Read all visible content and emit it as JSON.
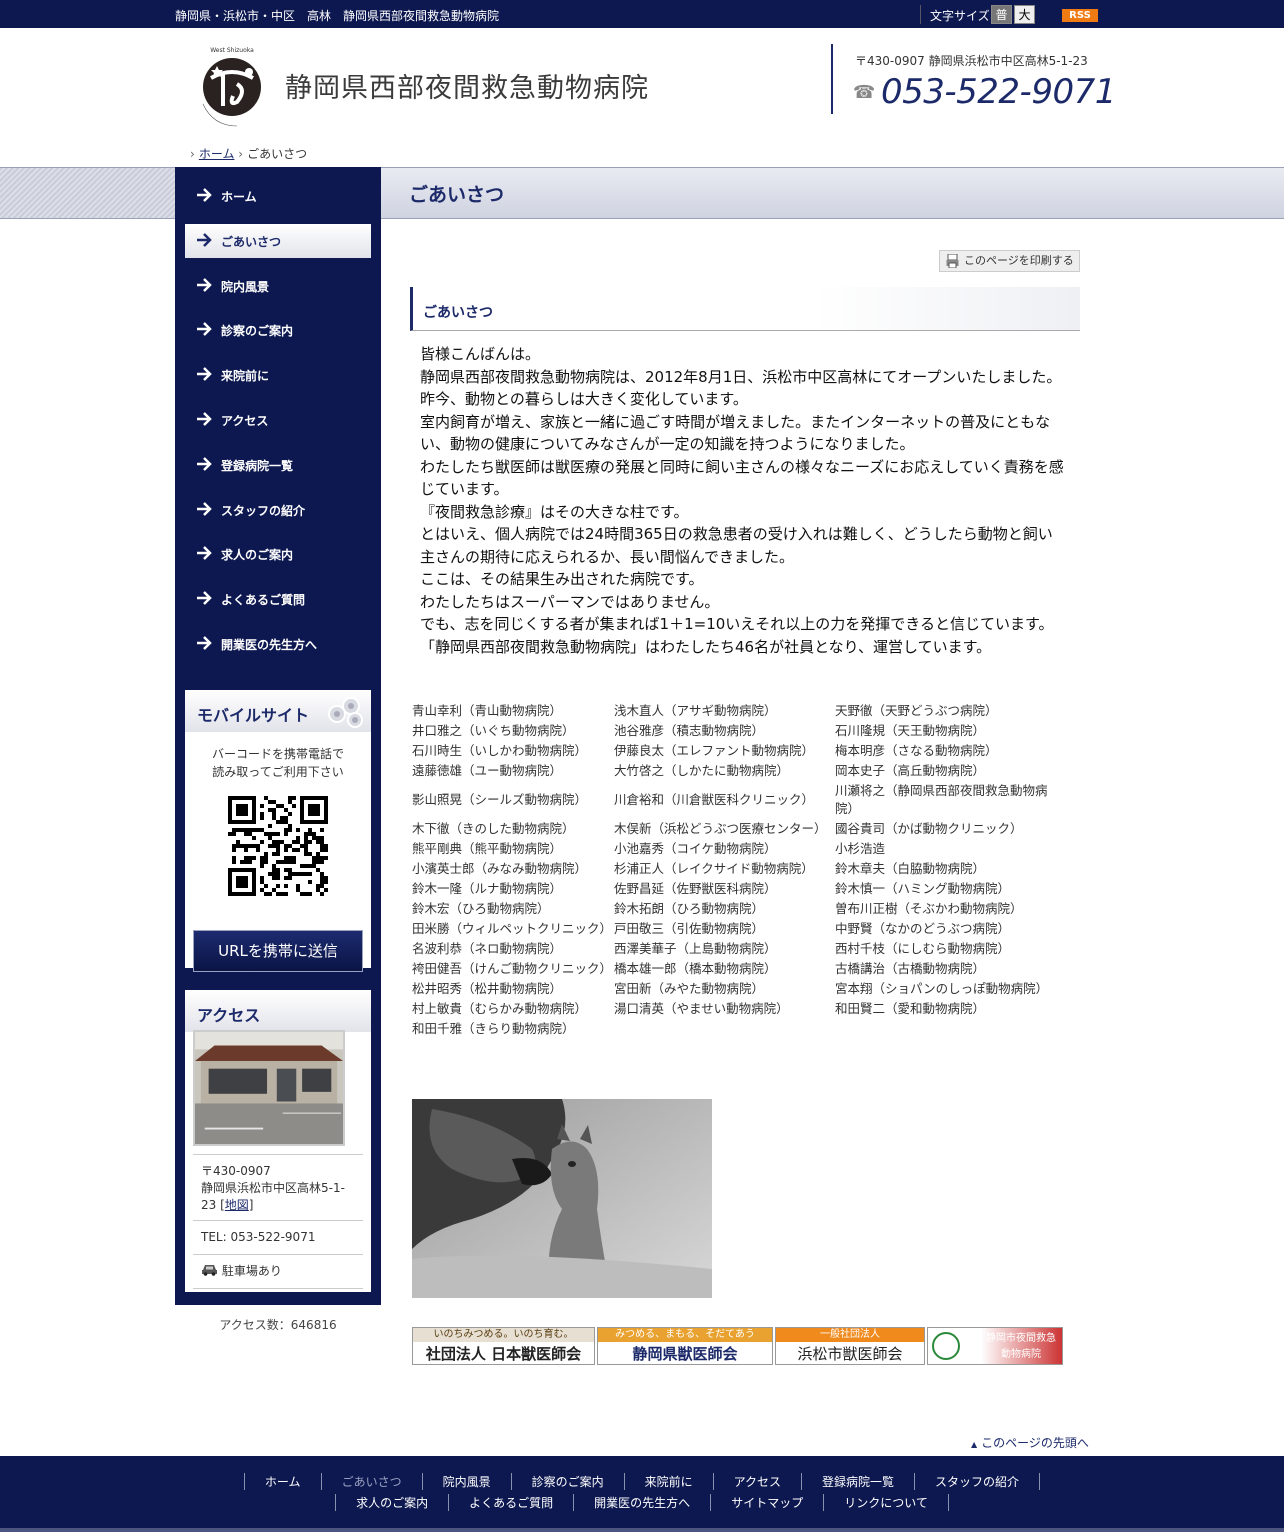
{
  "topbar": {
    "tagline": "静岡県・浜松市・中区　高林　静岡県西部夜間救急動物病院",
    "font_size_label": "文字サイズ",
    "font_size_normal": "普",
    "font_size_large": "大",
    "rss": "RSS"
  },
  "header": {
    "site_title": "静岡県西部夜間救急動物病院",
    "address": "〒430-0907 静岡県浜松市中区高林5-1-23",
    "phone": "053-522-9071"
  },
  "breadcrumb": {
    "home": "ホーム",
    "current": "ごあいさつ"
  },
  "page_heading": "ごあいさつ",
  "sidebar": {
    "nav": [
      {
        "label": "ホーム",
        "active": false
      },
      {
        "label": "ごあいさつ",
        "active": true
      },
      {
        "label": "院内風景",
        "active": false
      },
      {
        "label": "診察のご案内",
        "active": false
      },
      {
        "label": "来院前に",
        "active": false
      },
      {
        "label": "アクセス",
        "active": false
      },
      {
        "label": "登録病院一覧",
        "active": false
      },
      {
        "label": "スタッフの紹介",
        "active": false
      },
      {
        "label": "求人のご案内",
        "active": false
      },
      {
        "label": "よくあるご質問",
        "active": false
      },
      {
        "label": "開業医の先生方へ",
        "active": false
      }
    ],
    "mobile": {
      "title": "モバイルサイト",
      "text_line1": "バーコードを携帯電話で",
      "text_line2": "読み取ってご利用下さい",
      "url_button": "URLを携帯に送信"
    },
    "access": {
      "title": "アクセス",
      "postal": "〒430-0907",
      "address": "静岡県浜松市中区高林5-1-23",
      "map_link": "地図",
      "tel": "TEL: 053-522-9071",
      "parking": "駐車場あり"
    },
    "access_count": "アクセス数：646816"
  },
  "main": {
    "print_button": "このページを印刷する",
    "section_title": "ごあいさつ",
    "intro": [
      "皆様こんばんは。",
      "静岡県西部夜間救急動物病院は、2012年8月1日、浜松市中区高林にてオープンいたしました。",
      "昨今、動物との暮らしは大きく変化しています。",
      "室内飼育が増え、家族と一緒に過ごす時間が増えました。またインターネットの普及にともない、動物の健康についてみなさんが一定の知識を持つようになりました。",
      "わたしたち獣医師は獣医療の発展と同時に飼い主さんの様々なニーズにお応えしていく責務を感じています。",
      "『夜間救急診療』はその大きな柱です。",
      "とはいえ、個人病院では24時間365日の救急患者の受け入れは難しく、どうしたら動物と飼い主さんの期待に応えられるか、長い間悩んできました。",
      "ここは、その結果生み出された病院です。",
      "わたしたちはスーパーマンではありません。",
      "でも、志を同じくする者が集まれば1＋1=10いえそれ以上の力を発揮できると信じています。",
      "「静岡県西部夜間救急動物病院」はわたしたち46名が社員となり、運営しています。"
    ],
    "staff": [
      [
        "青山幸利（青山動物病院）",
        "浅木直人（アサギ動物病院）",
        "天野徹（天野どうぶつ病院）"
      ],
      [
        "井口雅之（いぐち動物病院）",
        "池谷雅彦（積志動物病院）",
        "石川隆規（天王動物病院）"
      ],
      [
        "石川時生（いしかわ動物病院）",
        "伊藤良太（エレファント動物病院）",
        "梅本明彦（さなる動物病院）"
      ],
      [
        "遠藤徳雄（ユー動物病院）",
        "大竹啓之（しかたに動物病院）",
        "岡本史子（高丘動物病院）"
      ],
      [
        "影山照晃（シールズ動物病院）",
        "川倉裕和（川倉獣医科クリニック）",
        "川瀬将之（静岡県西部夜間救急動物病院）"
      ],
      [
        "木下徹（きのした動物病院）",
        "木俣新（浜松どうぶつ医療センター）",
        "國谷貴司（かば動物クリニック）"
      ],
      [
        "熊平剛典（熊平動物病院）",
        "小池嘉秀（コイケ動物病院）",
        "小杉浩造"
      ],
      [
        "小濱英士郎（みなみ動物病院）",
        "杉浦正人（レイクサイド動物病院）",
        "鈴木章夫（白脇動物病院）"
      ],
      [
        "鈴木一隆（ルナ動物病院）",
        "佐野昌延（佐野獣医科病院）",
        "鈴木慎一（ハミング動物病院）"
      ],
      [
        "鈴木宏（ひろ動物病院）",
        "鈴木拓朗（ひろ動物病院）",
        "曽布川正樹（そぶかわ動物病院）"
      ],
      [
        "田米勝（ウィルペットクリニック）",
        "戸田敬三（引佐動物病院）",
        "中野賢（なかのどうぶつ病院）"
      ],
      [
        "名波利恭（ネロ動物病院）",
        "西澤美華子（上島動物病院）",
        "西村千枝（にしむら動物病院）"
      ],
      [
        "袴田健吾（けんご動物クリニック）",
        "橋本雄一郎（橋本動物病院）",
        "古橋講治（古橋動物病院）"
      ],
      [
        "松井昭秀（松井動物病院）",
        "宮田新（みやた動物病院）",
        "宮本翔（ショパンのしっぽ動物病院）"
      ],
      [
        "村上敏貴（むらかみ動物病院）",
        "湯口清英（やませい動物病院）",
        "和田賢二（愛和動物病院）"
      ],
      [
        "和田千雅（きらり動物病院）",
        "",
        ""
      ]
    ],
    "banners": {
      "jvma_top": "いのちみつめる。いのち育む。",
      "jvma_main": "社団法人 日本獣医師会",
      "shizuoka_top": "みつめる、まもる、そだてあう",
      "shizuoka_main": "静岡県獣医師会",
      "hamamatsu_top": "一般社団法人",
      "hamamatsu_main": "浜松市獣医師会",
      "shizuoka_city_line1": "静岡市夜間救急",
      "shizuoka_city_line2": "動物病院"
    },
    "to_top": "このページの先頭へ"
  },
  "footer": {
    "row1": [
      "ホーム",
      "ごあいさつ",
      "院内風景",
      "診察のご案内",
      "来院前に",
      "アクセス",
      "登録病院一覧",
      "スタッフの紹介"
    ],
    "row2": [
      "求人のご案内",
      "よくあるご質問",
      "開業医の先生方へ",
      "サイトマップ",
      "リンクについて"
    ]
  },
  "colors": {
    "navy": "#0d1850",
    "accent": "#1c2a6a",
    "rss": "#f07b12"
  }
}
